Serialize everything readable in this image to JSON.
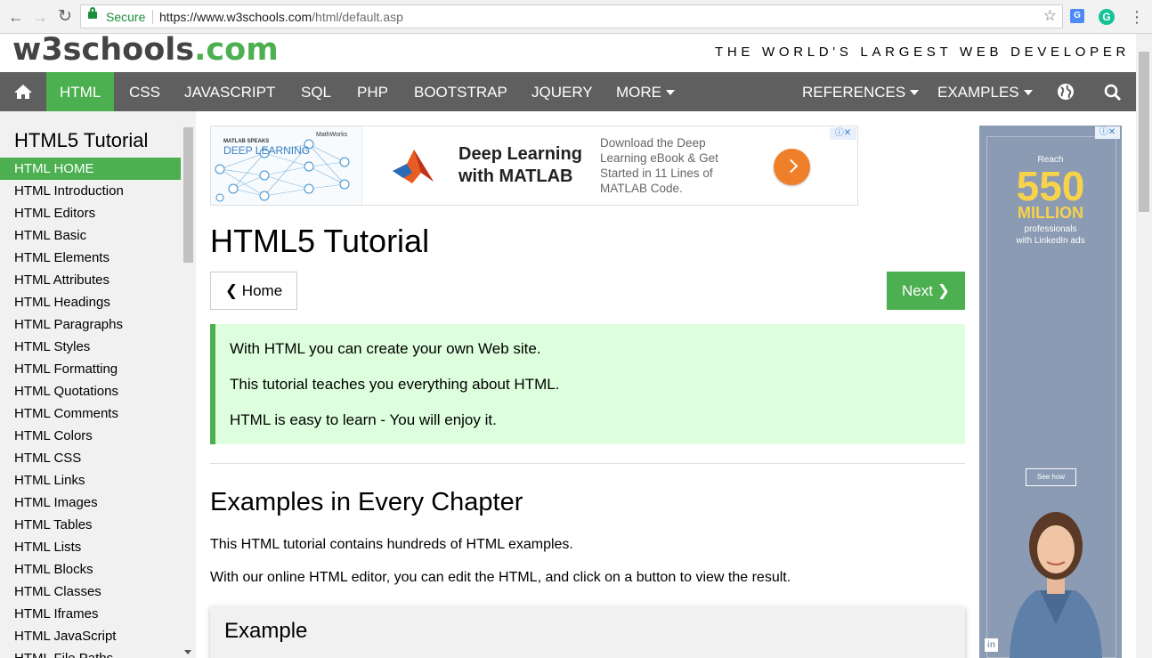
{
  "browser": {
    "back_icon": "back-arrow-icon",
    "forward_icon": "forward-arrow-icon",
    "reload_icon": "reload-icon",
    "secure_label": "Secure",
    "url_host": "https://www.w3schools.com",
    "url_path": "/html/default.asp",
    "bookmark_icon": "star-icon",
    "menu_icon": "more-vert-icon"
  },
  "site": {
    "logo_main": "w3schools",
    "logo_suffix": ".com",
    "tagline": "THE WORLD'S LARGEST WEB DEVELOPER SITE",
    "brand_color": "#4caf50",
    "nav_color": "#5f5f5f"
  },
  "topnav": {
    "items": [
      {
        "label": "HTML"
      },
      {
        "label": "CSS"
      },
      {
        "label": "JAVASCRIPT"
      },
      {
        "label": "SQL"
      },
      {
        "label": "PHP"
      },
      {
        "label": "BOOTSTRAP"
      },
      {
        "label": "JQUERY"
      },
      {
        "label": "MORE"
      },
      {
        "label": "REFERENCES"
      },
      {
        "label": "EXAMPLES"
      }
    ],
    "active": "HTML"
  },
  "sidebar": {
    "title": "HTML5 Tutorial",
    "items": [
      {
        "label": "HTML HOME"
      },
      {
        "label": "HTML Introduction"
      },
      {
        "label": "HTML Editors"
      },
      {
        "label": "HTML Basic"
      },
      {
        "label": "HTML Elements"
      },
      {
        "label": "HTML Attributes"
      },
      {
        "label": "HTML Headings"
      },
      {
        "label": "HTML Paragraphs"
      },
      {
        "label": "HTML Styles"
      },
      {
        "label": "HTML Formatting"
      },
      {
        "label": "HTML Quotations"
      },
      {
        "label": "HTML Comments"
      },
      {
        "label": "HTML Colors"
      },
      {
        "label": "HTML CSS"
      },
      {
        "label": "HTML Links"
      },
      {
        "label": "HTML Images"
      },
      {
        "label": "HTML Tables"
      },
      {
        "label": "HTML Lists"
      },
      {
        "label": "HTML Blocks"
      },
      {
        "label": "HTML Classes"
      },
      {
        "label": "HTML Iframes"
      },
      {
        "label": "HTML JavaScript"
      },
      {
        "label": "HTML File Paths"
      }
    ]
  },
  "ad_top": {
    "left_small": "MATLAB SPEAKS",
    "left_big": "DEEP LEARNING",
    "left_brand": "MathWorks",
    "headline_1": "Deep Learning",
    "headline_2": "with MATLAB",
    "description": "Download the Deep Learning eBook & Get Started in 11 Lines of MATLAB Code.",
    "adchoices": "ⓘ✕"
  },
  "main": {
    "title": "HTML5 Tutorial",
    "home_button": "❮ Home",
    "next_button": "Next ❯",
    "note_lines": [
      "With HTML you can create your own Web site.",
      "This tutorial teaches you everything about HTML.",
      "HTML is easy to learn - You will enjoy it."
    ],
    "section_title": "Examples in Every Chapter",
    "paragraph_1": "This HTML tutorial contains hundreds of HTML examples.",
    "paragraph_2": "With our online HTML editor, you can edit the HTML, and click on a button to view the result.",
    "example_title": "Example"
  },
  "ad_right": {
    "reach": "Reach",
    "number": "550",
    "unit": "MILLION",
    "line1": "professionals",
    "line2": "with LinkedIn ads",
    "cta": "See how",
    "brand_mark": "in",
    "adchoices": "ⓘ✕"
  }
}
